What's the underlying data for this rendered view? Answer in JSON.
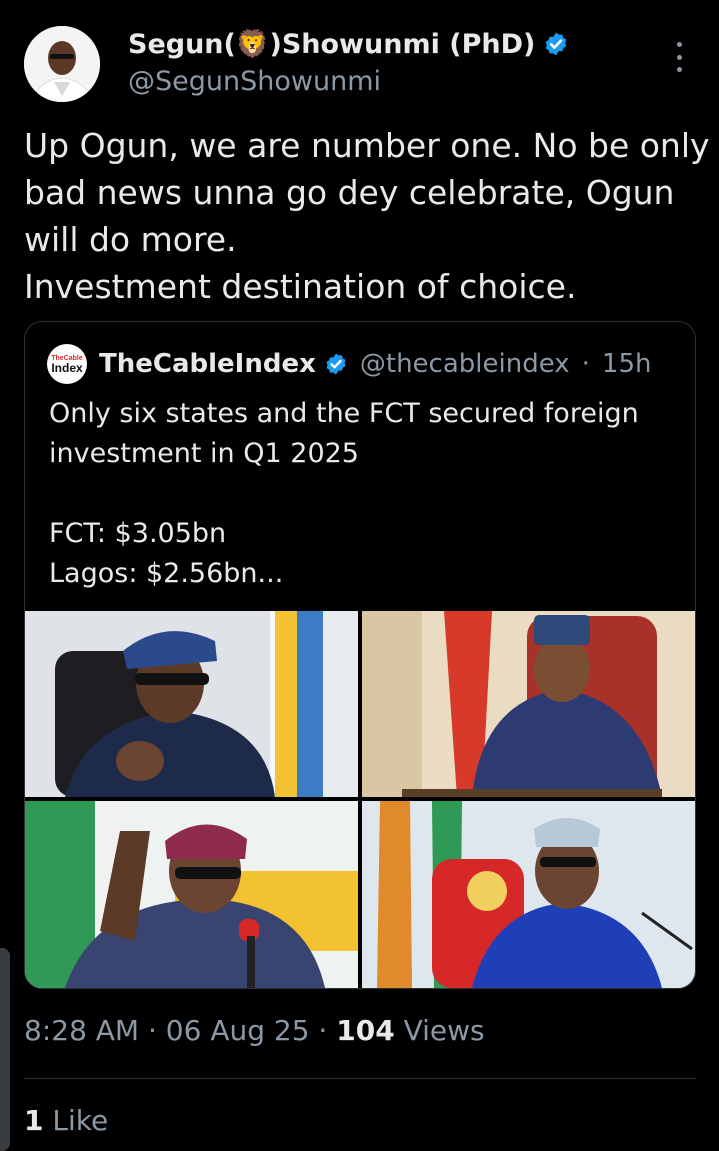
{
  "author": {
    "name_pre": "Segun(",
    "name_emoji": "🦁",
    "name_post": ")Showunmi (PhD)",
    "handle": "@SegunShowunmi",
    "verified_icon": "verified-badge-icon"
  },
  "tweet": {
    "lines": [
      "Up Ogun, we are number one. No be only",
      "bad news unna go dey celebrate, Ogun",
      "will do more.",
      "Investment destination of choice."
    ]
  },
  "quote": {
    "logo_top": "TheCable",
    "logo_bottom": "Index",
    "name": "TheCableIndex",
    "handle": "@thecableindex",
    "separator": "·",
    "time": "15h",
    "lines": [
      "Only six states and the FCT secured foreign",
      "investment in Q1 2025",
      "",
      "FCT: $3.05bn",
      "Lagos: $2.56bn..."
    ]
  },
  "meta": {
    "time": "8:28 AM",
    "sep1": " · ",
    "date": "06 Aug 25",
    "sep2": " · ",
    "views_count": "104",
    "views_label": " Views"
  },
  "likes": {
    "count": "1",
    "label": " Like"
  },
  "colors": {
    "background": "#000000",
    "text": "#e7e9ea",
    "muted": "#8b98a5",
    "verified": "#1d9bf0",
    "border": "#2f3336"
  }
}
